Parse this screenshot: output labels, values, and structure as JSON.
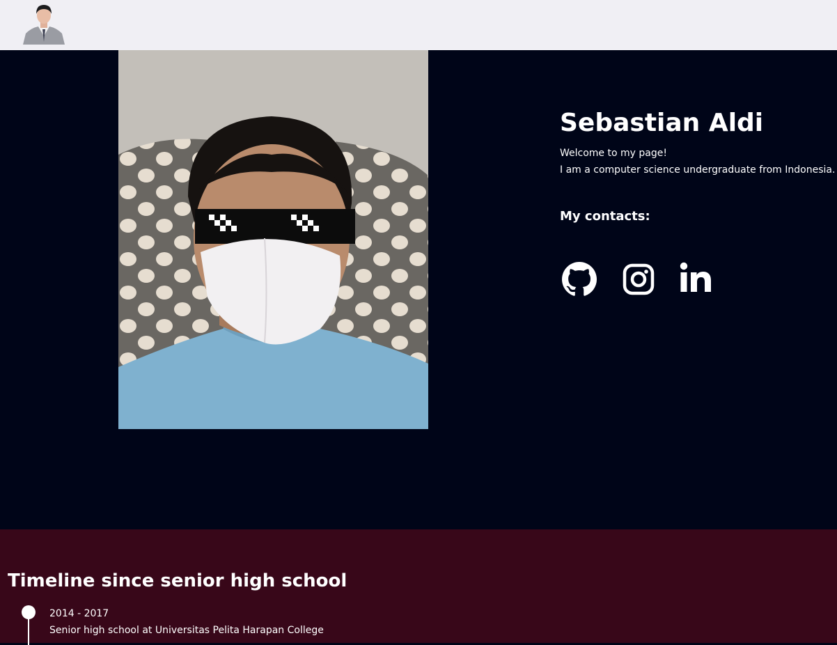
{
  "header": {
    "logo_icon": "profile-avatar-icon"
  },
  "hero": {
    "photo_icon": "profile-photo",
    "name": "Sebastian Aldi",
    "welcome": "Welcome to my page!",
    "about": "I am a computer science undergraduate from Indonesia.",
    "contacts_title": "My contacts:",
    "socials": [
      {
        "name": "GitHub",
        "icon": "github-icon"
      },
      {
        "name": "Instagram",
        "icon": "instagram-icon"
      },
      {
        "name": "LinkedIn",
        "icon": "linkedin-icon"
      }
    ]
  },
  "timeline": {
    "title": "Timeline since senior high school",
    "entries": [
      {
        "years": "2014 - 2017",
        "description": "Senior high school at Universitas Pelita Harapan College"
      }
    ]
  },
  "colors": {
    "topbar_bg": "#f0eff4",
    "hero_bg": "#000518",
    "timeline_bg": "#380719",
    "text": "#ffffff"
  }
}
